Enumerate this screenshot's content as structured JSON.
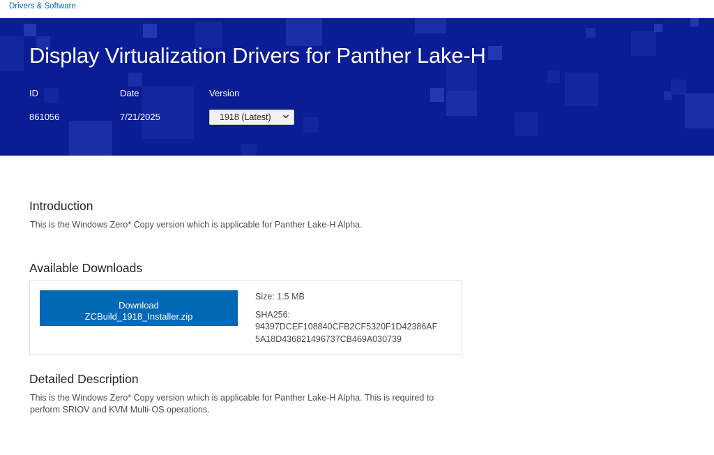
{
  "breadcrumb": {
    "label": "Drivers & Software"
  },
  "hero": {
    "title": "Display Virtualization Drivers for Panther Lake-H",
    "id_label": "ID",
    "id_value": "861056",
    "date_label": "Date",
    "date_value": "7/21/2025",
    "version_label": "Version",
    "version_selected": "1918 (Latest)",
    "background_color": "#0b1d95"
  },
  "introduction": {
    "heading": "Introduction",
    "text": "This is the Windows Zero* Copy version which is applicable for Panther Lake-H Alpha."
  },
  "downloads": {
    "heading": "Available Downloads",
    "button_line1": "Download",
    "button_line2": "ZCBuild_1918_Installer.zip",
    "size": "Size: 1.5 MB",
    "sha_label": "SHA256:",
    "sha_line1": "94397DCEF108840CFB2CF5320F1D42386AF",
    "sha_line2": "5A18D436821496737CB469A030739",
    "button_color": "#0068b5"
  },
  "detailed": {
    "heading": "Detailed Description",
    "text_line1": "This is the Windows Zero* Copy version which is applicable for Panther Lake-H Alpha. This is required to",
    "text_line2": "perform SRIOV and KVM Multi-OS operations."
  }
}
